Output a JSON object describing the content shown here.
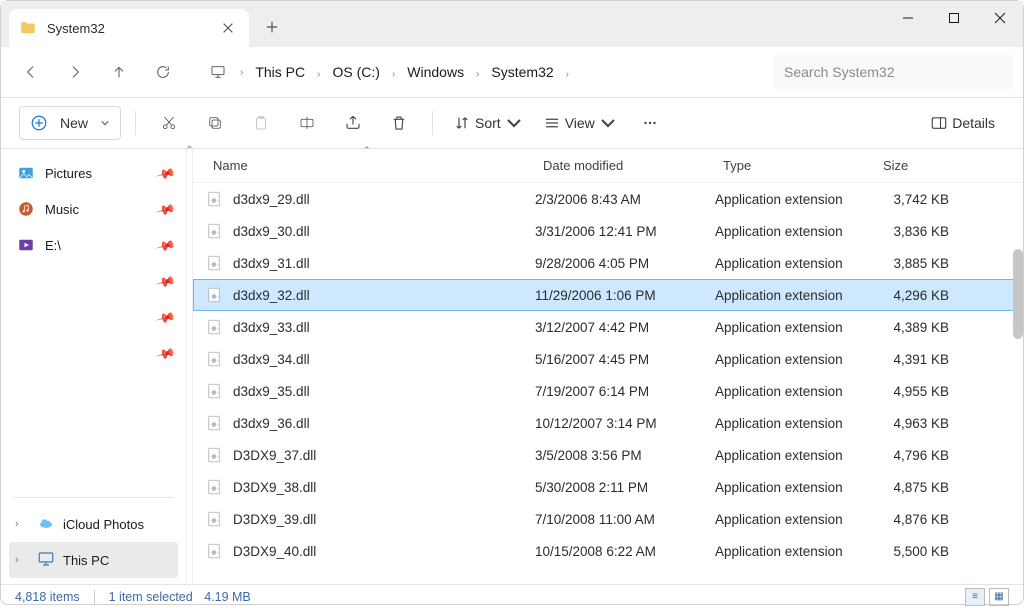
{
  "window": {
    "title": "System32"
  },
  "nav": {
    "crumbs": [
      "This PC",
      "OS (C:)",
      "Windows",
      "System32"
    ],
    "search_placeholder": "Search System32"
  },
  "toolbar": {
    "new_label": "New",
    "sort_label": "Sort",
    "view_label": "View",
    "details_label": "Details"
  },
  "sidebar": {
    "quick": [
      {
        "label": "Pictures",
        "icon": "pictures",
        "pinned": true
      },
      {
        "label": "Music",
        "icon": "music",
        "pinned": true
      },
      {
        "label": "E:\\",
        "icon": "drive",
        "pinned": true
      }
    ],
    "extra_pins": 3,
    "tree": [
      {
        "label": "iCloud Photos",
        "icon": "icloud",
        "selected": false
      },
      {
        "label": "This PC",
        "icon": "pc",
        "selected": true
      }
    ]
  },
  "columns": {
    "name": "Name",
    "date": "Date modified",
    "type": "Type",
    "size": "Size"
  },
  "files": [
    {
      "name": "d3dx9_29.dll",
      "date": "2/3/2006 8:43 AM",
      "type": "Application extension",
      "size": "3,742 KB",
      "selected": false
    },
    {
      "name": "d3dx9_30.dll",
      "date": "3/31/2006 12:41 PM",
      "type": "Application extension",
      "size": "3,836 KB",
      "selected": false
    },
    {
      "name": "d3dx9_31.dll",
      "date": "9/28/2006 4:05 PM",
      "type": "Application extension",
      "size": "3,885 KB",
      "selected": false
    },
    {
      "name": "d3dx9_32.dll",
      "date": "11/29/2006 1:06 PM",
      "type": "Application extension",
      "size": "4,296 KB",
      "selected": true
    },
    {
      "name": "d3dx9_33.dll",
      "date": "3/12/2007 4:42 PM",
      "type": "Application extension",
      "size": "4,389 KB",
      "selected": false
    },
    {
      "name": "d3dx9_34.dll",
      "date": "5/16/2007 4:45 PM",
      "type": "Application extension",
      "size": "4,391 KB",
      "selected": false
    },
    {
      "name": "d3dx9_35.dll",
      "date": "7/19/2007 6:14 PM",
      "type": "Application extension",
      "size": "4,955 KB",
      "selected": false
    },
    {
      "name": "d3dx9_36.dll",
      "date": "10/12/2007 3:14 PM",
      "type": "Application extension",
      "size": "4,963 KB",
      "selected": false
    },
    {
      "name": "D3DX9_37.dll",
      "date": "3/5/2008 3:56 PM",
      "type": "Application extension",
      "size": "4,796 KB",
      "selected": false
    },
    {
      "name": "D3DX9_38.dll",
      "date": "5/30/2008 2:11 PM",
      "type": "Application extension",
      "size": "4,875 KB",
      "selected": false
    },
    {
      "name": "D3DX9_39.dll",
      "date": "7/10/2008 11:00 AM",
      "type": "Application extension",
      "size": "4,876 KB",
      "selected": false
    },
    {
      "name": "D3DX9_40.dll",
      "date": "10/15/2008 6:22 AM",
      "type": "Application extension",
      "size": "5,500 KB",
      "selected": false
    }
  ],
  "status": {
    "count_label": "4,818 items",
    "selection_label": "1 item selected",
    "selection_size": "4.19 MB"
  }
}
